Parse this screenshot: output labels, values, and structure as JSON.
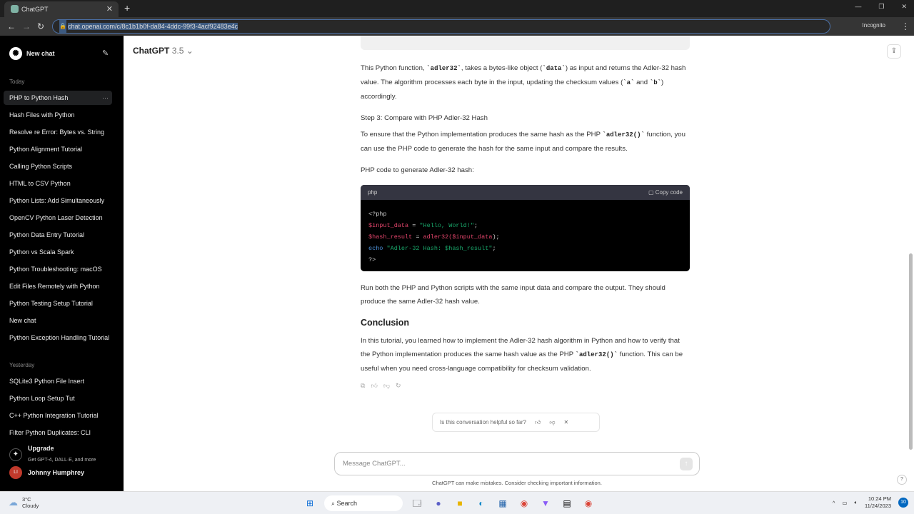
{
  "browser": {
    "tab_title": "ChatGPT",
    "url": "chat.openai.com/c/8c1b1b0f-da84-4ddc-99f3-4acf92483e4c",
    "profile": "Incognito"
  },
  "sidebar": {
    "new_chat": "New chat",
    "today_label": "Today",
    "today": [
      "PHP to Python Hash",
      "Hash Files with Python",
      "Resolve re Error: Bytes vs. String",
      "Python Alignment Tutorial",
      "Calling Python Scripts",
      "HTML to CSV Python",
      "Python Lists: Add Simultaneously",
      "OpenCV Python Laser Detection",
      "Python Data Entry Tutorial",
      "Python vs Scala Spark",
      "Python Troubleshooting: macOS",
      "Edit Files Remotely with Python",
      "Python Testing Setup Tutorial",
      "New chat",
      "Python Exception Handling Tutorial"
    ],
    "yesterday_label": "Yesterday",
    "yesterday": [
      "SQLite3 Python File Insert",
      "Python Loop Setup Tut",
      "C++ Python Integration Tutorial",
      "Filter Python Duplicates: CLI"
    ],
    "upgrade_title": "Upgrade",
    "upgrade_sub": "Get GPT-4, DALL·E, and more",
    "user_initials": "LI",
    "user_name": "Johnny Humphrey"
  },
  "header": {
    "model": "ChatGPT",
    "version": "3.5"
  },
  "content": {
    "p1a": "This Python function, ",
    "p1code1": "`adler32`",
    "p1b": ", takes a bytes-like object (",
    "p1code2": "`data`",
    "p1c": ") as input and returns the Adler-32 hash value. The algorithm processes each byte in the input, updating the checksum values (",
    "p1code3": "`a`",
    "p1d": " and ",
    "p1code4": "`b`",
    "p1e": ") accordingly.",
    "step3": "Step 3: Compare with PHP Adler-32 Hash",
    "p2a": "To ensure that the Python implementation produces the same hash as the PHP ",
    "p2code": "`adler32()`",
    "p2b": " function, you can use the PHP code to generate the hash for the same input and compare the results.",
    "p3": "PHP code to generate Adler-32 hash:",
    "code_lang": "php",
    "copy_label": "Copy code",
    "code": {
      "l1": "<?php",
      "l2v": "$input_data",
      "l2a": " = ",
      "l2s": "\"Hello, World!\"",
      "l2e": ";",
      "l3v": "$hash_result",
      "l3a": " = ",
      "l3f": "adler32(",
      "l3v2": "$input_data",
      "l3e": ");",
      "l4k": "echo",
      "l4s": " \"Adler-32 Hash: $hash_result\"",
      "l4e": ";",
      "l5": "?>"
    },
    "p4": "Run both the PHP and Python scripts with the same input data and compare the output. They should produce the same Adler-32 hash value.",
    "conclusion": "Conclusion",
    "p5a": "In this tutorial, you learned how to implement the Adler-32 hash algorithm in Python and how to verify that the Python implementation produces the same hash value as the PHP ",
    "p5code": "`adler32()`",
    "p5b": " function. This can be useful when you need cross-language compatibility for checksum validation."
  },
  "feedback": "Is this conversation helpful so far?",
  "composer": {
    "placeholder": "Message ChatGPT...",
    "disclaimer": "ChatGPT can make mistakes. Consider checking important information."
  },
  "taskbar": {
    "temp": "3°C",
    "weather": "Cloudy",
    "search": "Search",
    "time": "10:24 PM",
    "date": "11/24/2023",
    "notifications": "10"
  }
}
